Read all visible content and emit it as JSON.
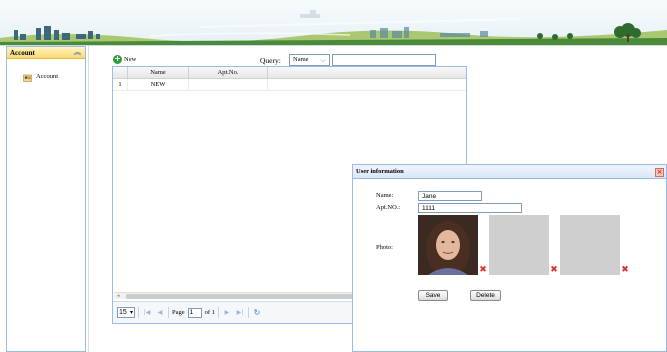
{
  "west": {
    "panel_title": "Account",
    "items": [
      {
        "label": "Account",
        "icon": "account-icon"
      }
    ]
  },
  "toolbar": {
    "new_label": "New",
    "query_label": "Query:",
    "query_field_selected": "Name",
    "query_value": ""
  },
  "grid": {
    "columns": [
      "",
      "Name",
      "Apt.No."
    ],
    "rows": [
      {
        "index": "1",
        "name": "NEW",
        "apt": ""
      }
    ]
  },
  "pager": {
    "page_size": "15",
    "page_label": "Page",
    "page_value": "1",
    "of_label": "of 1"
  },
  "dialog": {
    "title": "User information",
    "name_label": "Name:",
    "name_value": "Jane",
    "apt_label": "Apt.NO.:",
    "apt_value": "1111",
    "photo_label": "Photo:",
    "save_label": "Save",
    "delete_label": "Delete"
  },
  "colors": {
    "panel_border": "#99bbe8",
    "accordion_header": "#f9d971",
    "delete_icon": "#e03030",
    "new_icon": "#2f9a3a"
  }
}
